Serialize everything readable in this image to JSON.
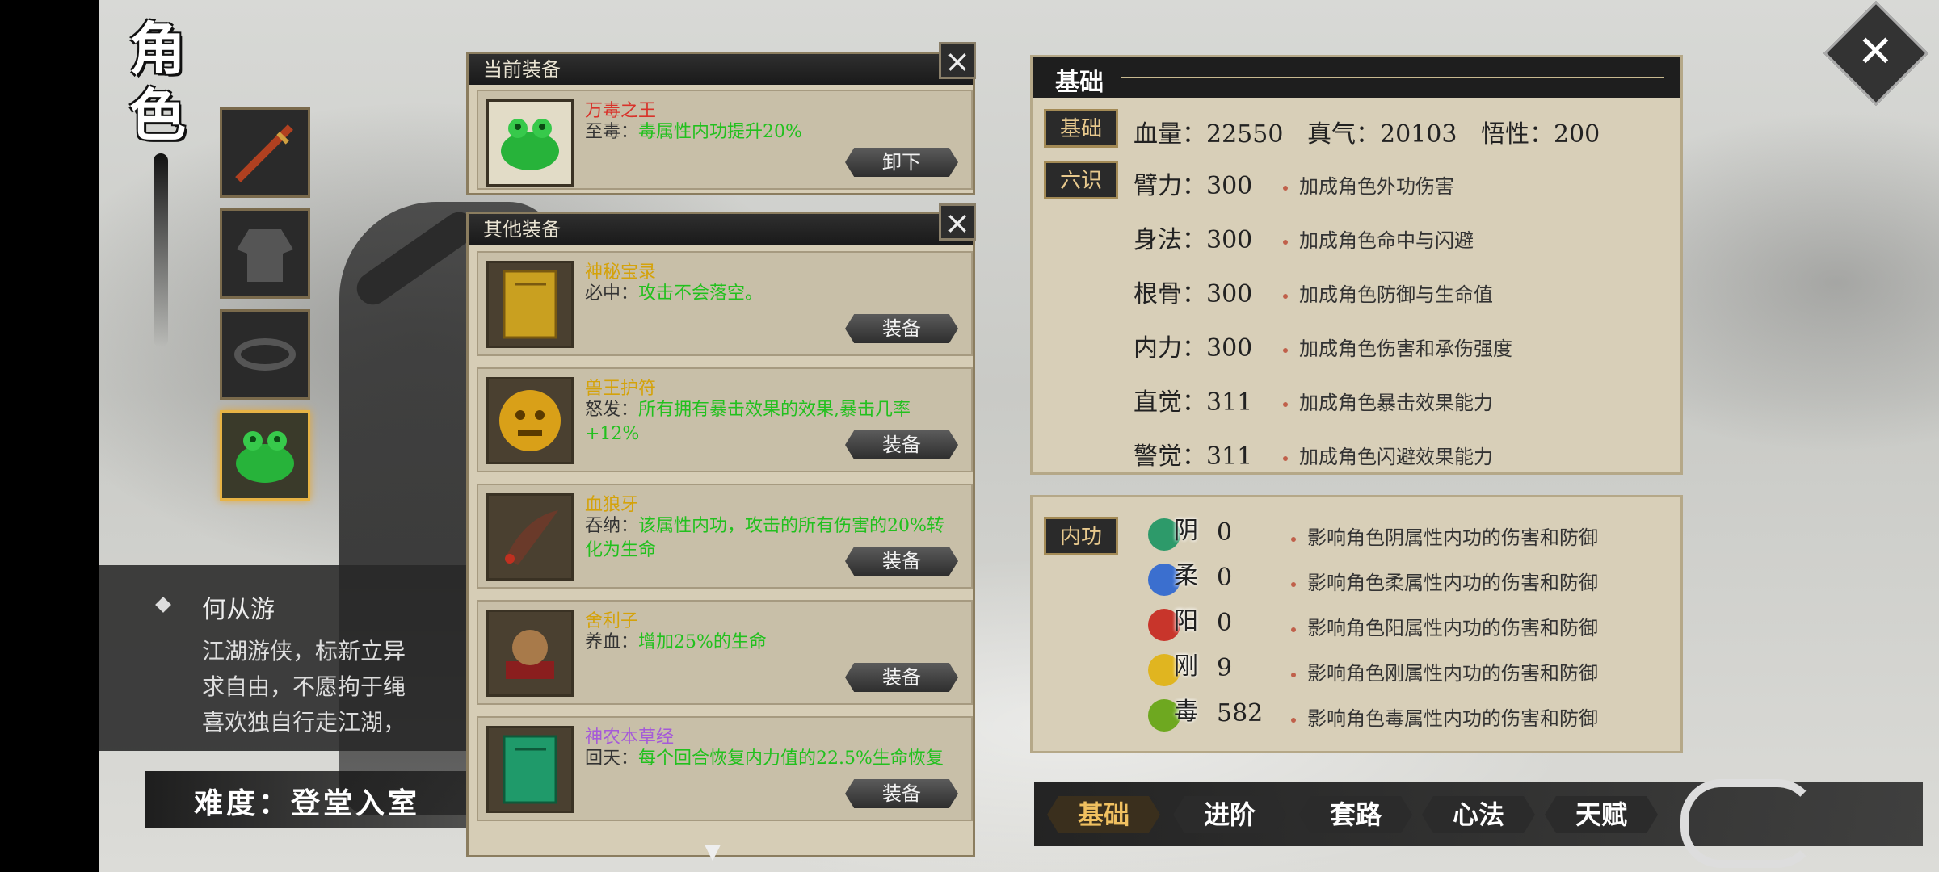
{
  "screen": {
    "title": "角色",
    "character": {
      "name": "何从游",
      "description": "江湖游侠，标新立异\n求自由，不愿拘于绳\n喜欢独自行走江湖，",
      "difficulty": "难度：登堂入室"
    },
    "current_equipment": {
      "header": "当前装备",
      "item": {
        "name": "万毒之王",
        "effect_label": "至毒：",
        "effect_text": "毒属性内功提升20%",
        "button": "卸下"
      }
    },
    "other_equipment": {
      "header": "其他装备",
      "items": [
        {
          "name": "神秘宝录",
          "effect_label": "必中：",
          "effect_text": "攻击不会落空。",
          "button": "装备"
        },
        {
          "name": "兽王护符",
          "effect_label": "怒发：",
          "effect_text": "所有拥有暴击效果的效果,暴击几率+12%",
          "button": "装备"
        },
        {
          "name": "血狼牙",
          "effect_label": "吞纳：",
          "effect_text": "该属性内功，攻击的所有伤害的20%转化为生命",
          "button": "装备"
        },
        {
          "name": "舍利子",
          "effect_label": "养血：",
          "effect_text": "增加25%的生命",
          "button": "装备"
        },
        {
          "name": "神农本草经",
          "effect_label": "回天：",
          "effect_text": "每个回合恢复内力值的22.5%生命恢复",
          "button": "装备"
        }
      ]
    },
    "stats": {
      "section_title": "基础",
      "basic_tag": "基础",
      "six_tag": "六识",
      "hp_label": "血量：",
      "hp_value": "22550",
      "qi_label": "真气：",
      "qi_value": "20103",
      "wu_label": "悟性：",
      "wu_value": "200",
      "rows": [
        {
          "label": "臂力：",
          "value": "300",
          "desc": "加成角色外功伤害"
        },
        {
          "label": "身法：",
          "value": "300",
          "desc": "加成角色命中与闪避"
        },
        {
          "label": "根骨：",
          "value": "300",
          "desc": "加成角色防御与生命值"
        },
        {
          "label": "内力：",
          "value": "300",
          "desc": "加成角色伤害和承伤强度"
        },
        {
          "label": "直觉：",
          "value": "311",
          "desc": "加成角色暴击效果能力"
        },
        {
          "label": "警觉：",
          "value": "311",
          "desc": "加成角色闪避效果能力"
        }
      ]
    },
    "inner": {
      "tag": "内功",
      "rows": [
        {
          "char": "阴",
          "value": "0",
          "desc": "影响角色阴属性内功的伤害和防御",
          "color": "#2d9a6a"
        },
        {
          "char": "柔",
          "value": "0",
          "desc": "影响角色柔属性内功的伤害和防御",
          "color": "#3b6fcf"
        },
        {
          "char": "阳",
          "value": "0",
          "desc": "影响角色阳属性内功的伤害和防御",
          "color": "#c8352b"
        },
        {
          "char": "刚",
          "value": "9",
          "desc": "影响角色刚属性内功的伤害和防御",
          "color": "#e0b520"
        },
        {
          "char": "毒",
          "value": "582",
          "desc": "影响角色毒属性内功的伤害和防御",
          "color": "#6ea820"
        }
      ]
    },
    "tabs": [
      "基础",
      "进阶",
      "套路",
      "心法",
      "天赋"
    ],
    "active_tab": "基础",
    "colors": {
      "accent": "#e7b345",
      "effect_green": "#22c01e",
      "item_red": "#d8322a",
      "item_gold": "#d4a20a",
      "item_purple": "#a55ad8"
    }
  }
}
